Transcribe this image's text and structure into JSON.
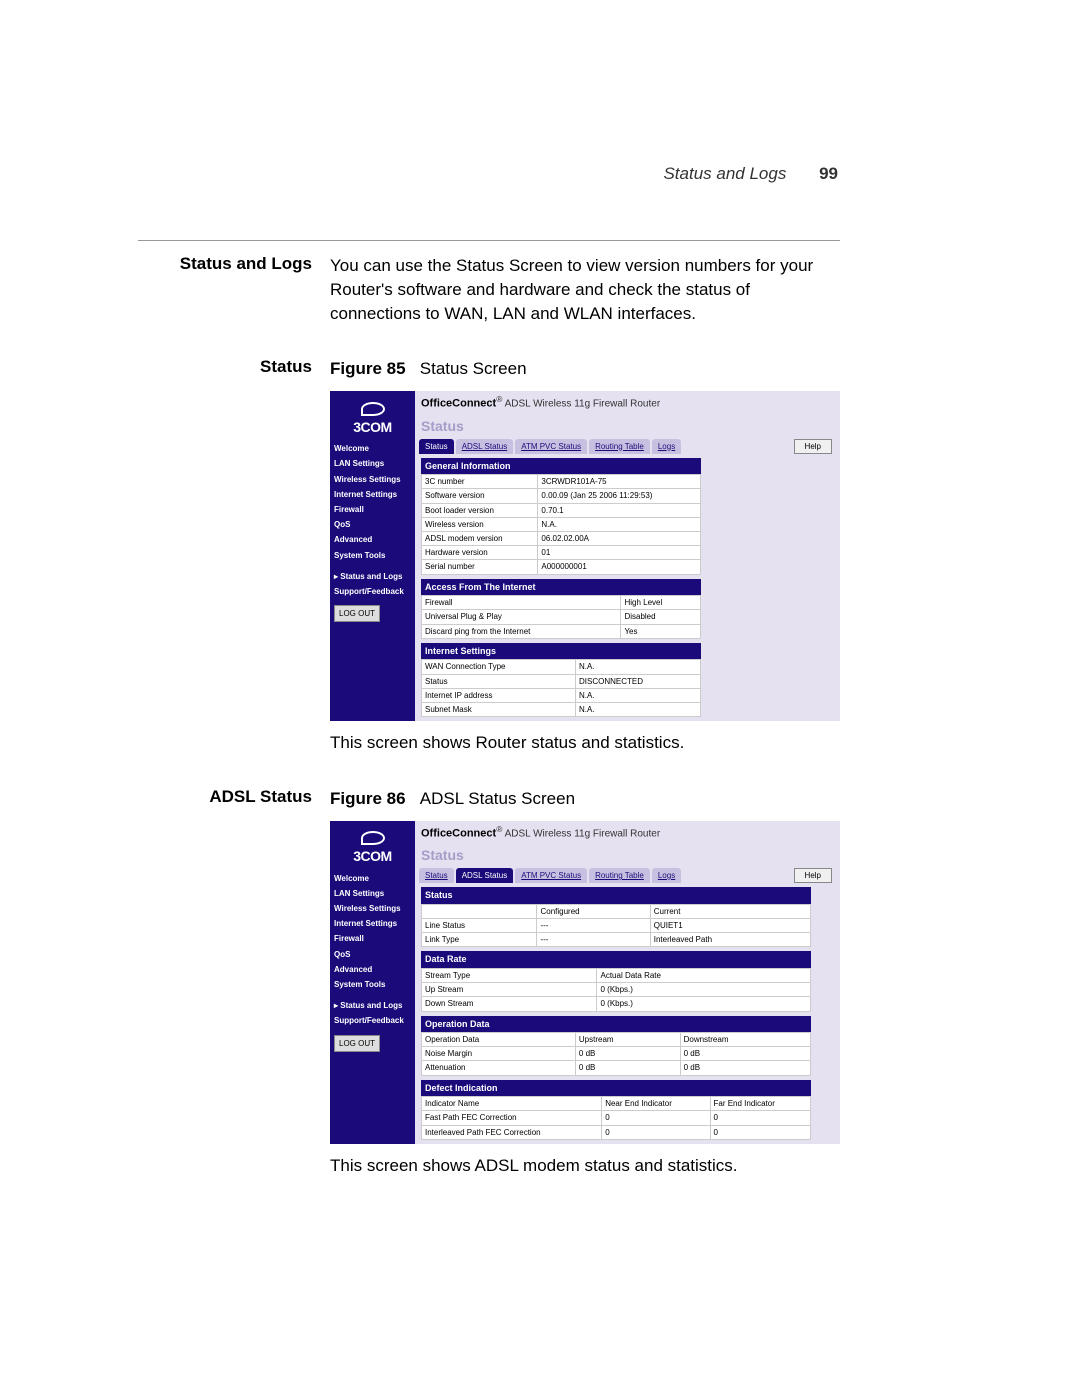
{
  "header": {
    "title": "Status and Logs",
    "page": "99"
  },
  "section": {
    "heading": "Status and Logs",
    "intro": "You can use the Status Screen to view version numbers for your Router's software and hardware and check the status of connections to WAN, LAN and WLAN interfaces."
  },
  "fig85": {
    "label": "Status",
    "figref": "Figure 85",
    "figtitle": "Status Screen",
    "caption": "This screen shows Router status and statistics."
  },
  "fig86": {
    "label": "ADSL Status",
    "figref": "Figure 86",
    "figtitle": "ADSL Status Screen",
    "caption": "This screen shows ADSL modem status and statistics."
  },
  "router": {
    "brand1": "OfficeConnect",
    "brand2": "ADSL Wireless 11g Firewall Router",
    "logo": "3COM",
    "pane_title": "Status",
    "tabs": [
      "Status",
      "ADSL Status",
      "ATM PVC Status",
      "Routing Table",
      "Logs"
    ],
    "help": "Help",
    "logout": "LOG OUT",
    "sidebar": [
      "Welcome",
      "LAN Settings",
      "Wireless Settings",
      "Internet Settings",
      "Firewall",
      "QoS",
      "Advanced",
      "System Tools",
      "Status and Logs",
      "Support/Feedback"
    ]
  },
  "status_screen": {
    "sections": {
      "general": {
        "title": "General Information",
        "rows": [
          [
            "3C number",
            "3CRWDR101A-75"
          ],
          [
            "Software version",
            "0.00.09 (Jan 25 2006 11:29:53)"
          ],
          [
            "Boot loader version",
            "0.70.1"
          ],
          [
            "Wireless version",
            "N.A."
          ],
          [
            "ADSL modem version",
            "06.02.02.00A"
          ],
          [
            "Hardware version",
            "01"
          ],
          [
            "Serial number",
            "A000000001"
          ]
        ]
      },
      "access": {
        "title": "Access From The Internet",
        "rows": [
          [
            "Firewall",
            "High Level"
          ],
          [
            "Universal Plug & Play",
            "Disabled"
          ],
          [
            "Discard ping from the Internet",
            "Yes"
          ]
        ]
      },
      "internet": {
        "title": "Internet Settings",
        "rows": [
          [
            "WAN Connection Type",
            "N.A."
          ],
          [
            "Status",
            "DISCONNECTED"
          ],
          [
            "Internet IP address",
            "N.A."
          ],
          [
            "Subnet Mask",
            "N.A."
          ]
        ]
      }
    }
  },
  "adsl_screen": {
    "sections": {
      "status": {
        "title": "Status",
        "rows": [
          [
            "",
            "Configured",
            "Current"
          ],
          [
            "Line Status",
            "---",
            "QUIET1"
          ],
          [
            "Link Type",
            "---",
            "Interleaved Path"
          ]
        ]
      },
      "datarate": {
        "title": "Data Rate",
        "rows": [
          [
            "Stream Type",
            "Actual Data Rate",
            ""
          ],
          [
            "Up Stream",
            "0 (Kbps.)",
            ""
          ],
          [
            "Down Stream",
            "0 (Kbps.)",
            ""
          ]
        ]
      },
      "opdata": {
        "title": "Operation Data",
        "rows": [
          [
            "Operation Data",
            "Upstream",
            "Downstream"
          ],
          [
            "Noise Margin",
            "0 dB",
            "0 dB"
          ],
          [
            "Attenuation",
            "0 dB",
            "0 dB"
          ]
        ]
      },
      "defect": {
        "title": "Defect Indication",
        "rows": [
          [
            "Indicator Name",
            "Near End Indicator",
            "Far End Indicator"
          ],
          [
            "Fast Path FEC Correction",
            "0",
            "0"
          ],
          [
            "Interleaved Path FEC Correction",
            "0",
            "0"
          ]
        ]
      }
    }
  }
}
